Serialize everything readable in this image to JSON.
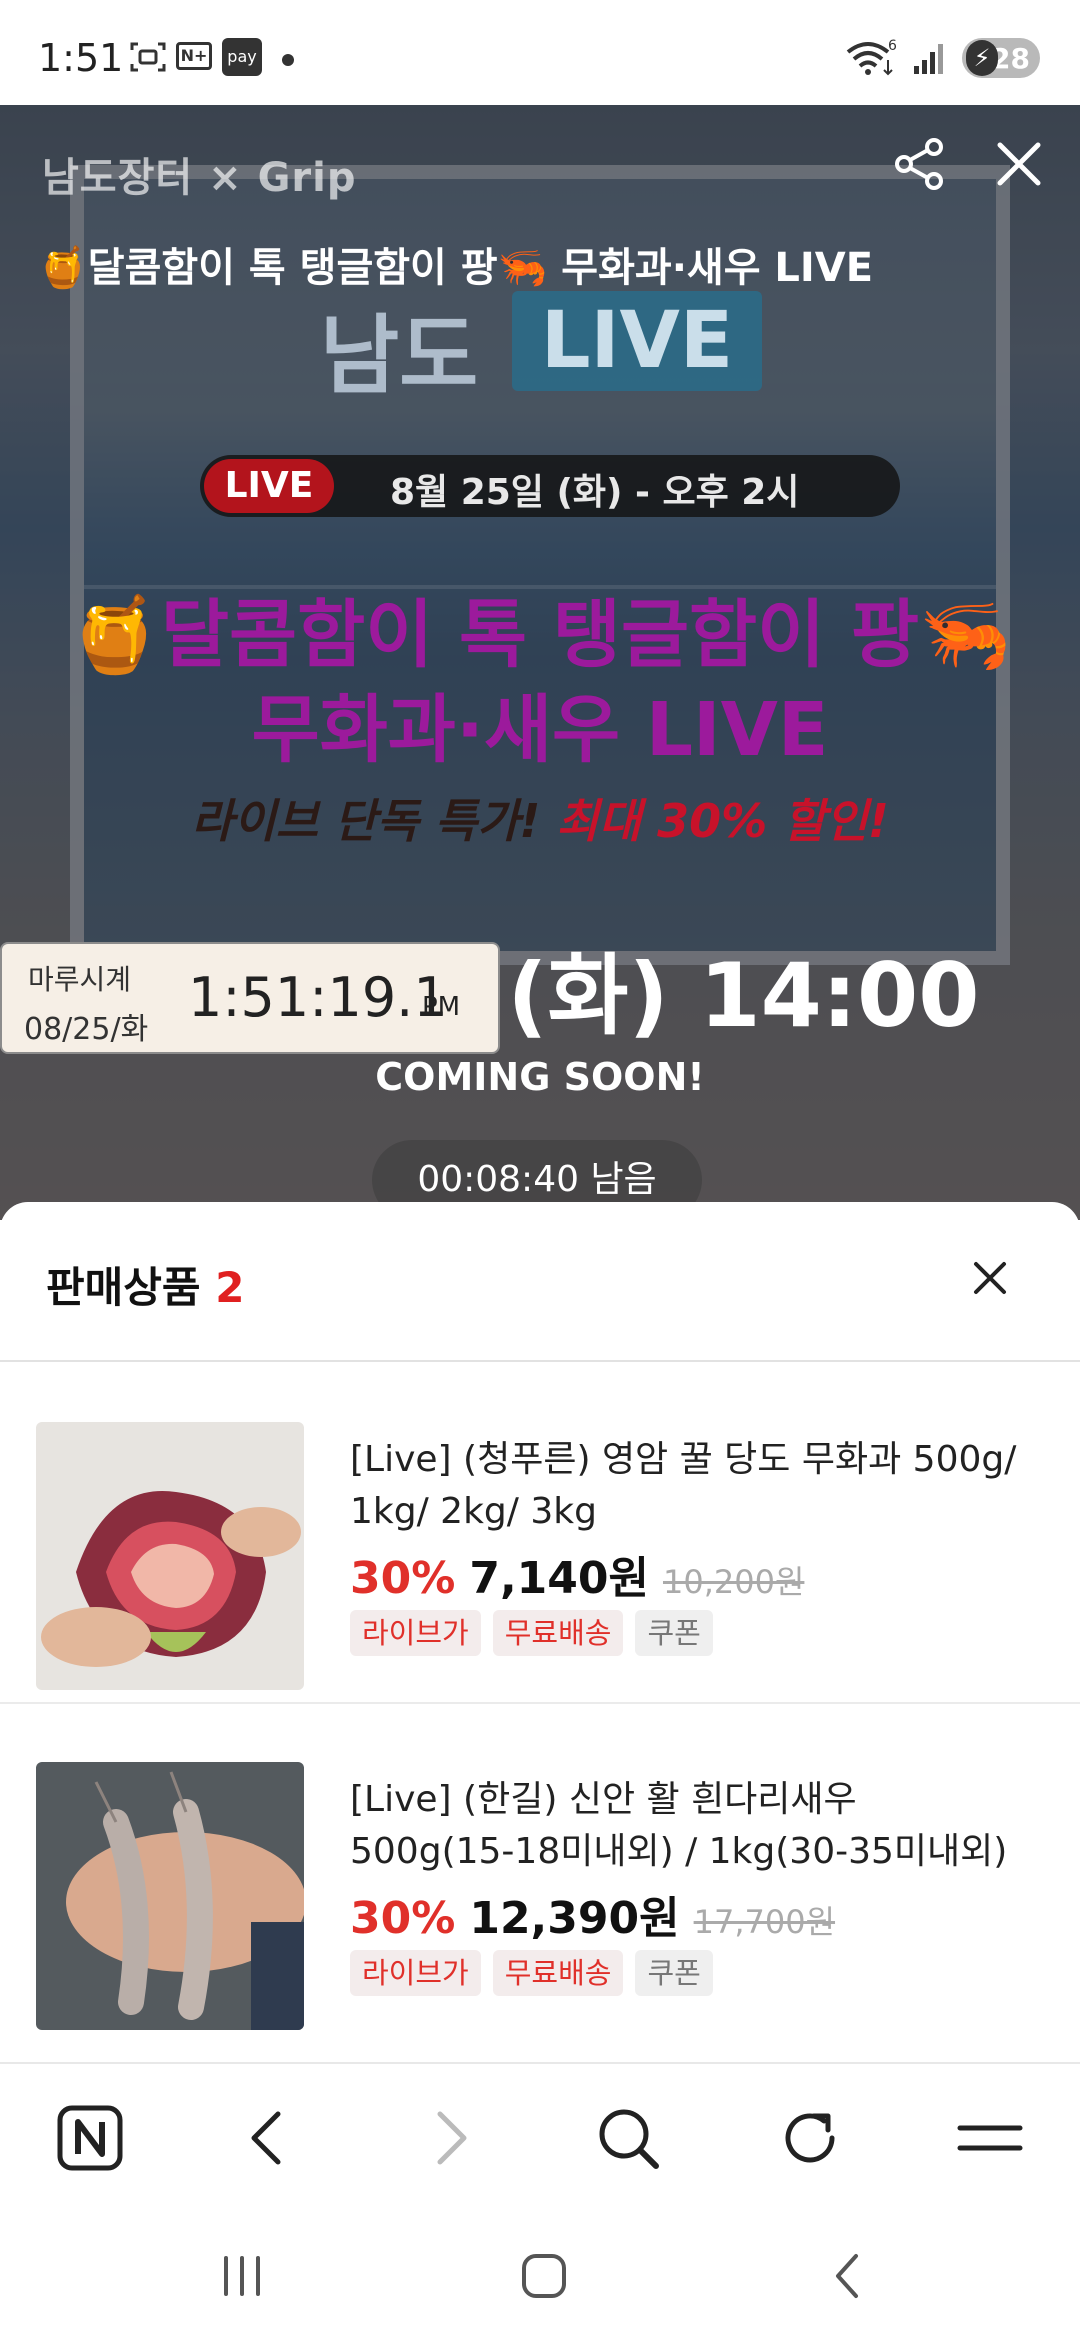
{
  "status_bar": {
    "time": "1:51",
    "battery": "28",
    "network_badge": "6",
    "pay_label": "pay",
    "nplus_label": "N+"
  },
  "hero": {
    "brand": "남도장터 × Grip",
    "title": "🍯달콤함이 톡 탱글함이 팡🦐 무화과·새우 LIVE",
    "live_brand_prefix": "남도",
    "live_brand_box": "LIVE",
    "live_pill": "LIVE",
    "live_date": "8월 25일 (화) - 오후 2시",
    "promo_line1": "🍯달콤함이 톡 탱글함이 팡🦐",
    "promo_line2": "무화과·새우 LIVE",
    "promo_line3_plain": "라이브 단독 특가! ",
    "promo_line3_red": "최대 30% 할인!",
    "broadcast_time": "8월 25일 (화) 14:00",
    "coming_soon": "COMING SOON!",
    "remaining": "00:08:40 남음",
    "icons": {
      "share": "share-icon",
      "close": "close-icon"
    }
  },
  "clock_widget": {
    "name": "마루시계",
    "date": "08/25/화",
    "time": "1:51:19.1",
    "ampm": "PM"
  },
  "sheet": {
    "title": "판매상품",
    "count": "2",
    "products": [
      {
        "name": "[Live] (청푸른) 영암 꿀 당도 무화과 500g/ 1kg/ 2kg/ 3kg",
        "discount": "30%",
        "price": "7,140원",
        "original_price": "10,200원",
        "tags": [
          "라이브가",
          "무료배송",
          "쿠폰"
        ]
      },
      {
        "name": "[Live] (한길) 신안 활 흰다리새우 500g(15-18미내외) / 1kg(30-35미내외)",
        "discount": "30%",
        "price": "12,390원",
        "original_price": "17,700원",
        "tags": [
          "라이브가",
          "무료배송",
          "쿠폰"
        ]
      }
    ]
  },
  "toolbar": {
    "items": [
      "naver-home-icon",
      "back-icon",
      "forward-icon",
      "search-icon",
      "refresh-icon",
      "menu-icon"
    ]
  },
  "colors": {
    "accent_red": "#e0302a",
    "live_red": "#b3141c",
    "promo_purple": "#9c1a9c"
  }
}
